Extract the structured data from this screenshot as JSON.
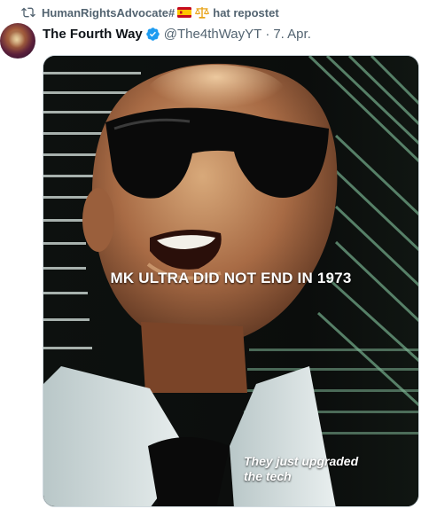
{
  "repost": {
    "user": "HumanRightsAdvocate#",
    "suffix": "hat repostet",
    "icon": "repost-icon",
    "emoji": [
      "spain-flag-icon",
      "scales-icon"
    ]
  },
  "tweet": {
    "author_name": "The Fourth Way",
    "verified": true,
    "handle": "@The4thWayYT",
    "separator": "·",
    "date": "7. Apr."
  },
  "media": {
    "caption_main": "MK ULTRA DID NOT END IN 1973",
    "caption_sub_line1": "They just upgraded",
    "caption_sub_line2": "the tech"
  },
  "colors": {
    "text_primary": "#0f1419",
    "text_secondary": "#536471",
    "verified_blue": "#1d9bf0"
  }
}
